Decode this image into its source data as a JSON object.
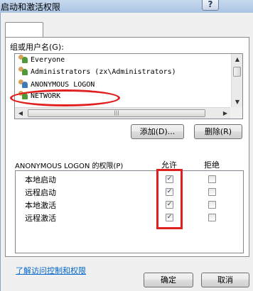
{
  "window": {
    "title": "启动和激活权限",
    "help_label": "?"
  },
  "group": {
    "label": "组或用户名(G):",
    "users": [
      {
        "name": "Everyone",
        "icon": "users-icon"
      },
      {
        "name": "Administrators (zx\\Administrators)",
        "icon": "users-icon"
      },
      {
        "name": "ANONYMOUS LOGON",
        "icon": "users-icon",
        "selected": true
      },
      {
        "name": "NETWORK",
        "icon": "users-icon"
      }
    ]
  },
  "buttons": {
    "add": "添加(D)...",
    "remove": "删除(R)",
    "ok": "确定",
    "cancel": "取消"
  },
  "permissions": {
    "label": "ANONYMOUS LOGON 的权限(P)",
    "allow_header": "允许",
    "deny_header": "拒绝",
    "items": [
      {
        "name": "本地启动",
        "allow": true,
        "deny": false
      },
      {
        "name": "远程启动",
        "allow": true,
        "deny": false
      },
      {
        "name": "本地激活",
        "allow": true,
        "deny": false
      },
      {
        "name": "远程激活",
        "allow": true,
        "deny": false
      }
    ]
  },
  "link": "了解访问控制和权限",
  "annotation_color": "#e0201f"
}
